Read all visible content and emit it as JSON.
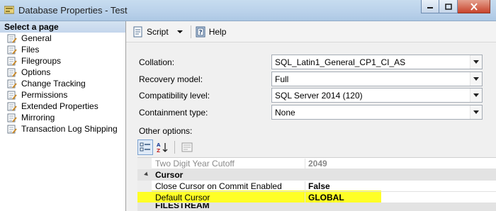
{
  "window": {
    "title": "Database Properties - Test"
  },
  "left_pane": {
    "header": "Select a page",
    "items": [
      {
        "label": "General"
      },
      {
        "label": "Files"
      },
      {
        "label": "Filegroups"
      },
      {
        "label": "Options"
      },
      {
        "label": "Change Tracking"
      },
      {
        "label": "Permissions"
      },
      {
        "label": "Extended Properties"
      },
      {
        "label": "Mirroring"
      },
      {
        "label": "Transaction Log Shipping"
      }
    ]
  },
  "toolbar": {
    "script_label": "Script",
    "help_label": "Help"
  },
  "options": {
    "collation": {
      "label": "Collation:",
      "value": "SQL_Latin1_General_CP1_CI_AS"
    },
    "recovery_model": {
      "label": "Recovery model:",
      "value": "Full"
    },
    "compatibility_level": {
      "label": "Compatibility level:",
      "value": "SQL Server 2014 (120)"
    },
    "containment_type": {
      "label": "Containment type:",
      "value": "None"
    },
    "other_options_label": "Other options:"
  },
  "property_grid": {
    "rows": [
      {
        "name": "Two Digit Year Cutoff",
        "value": "2049",
        "kind": "disabled"
      },
      {
        "name": "Cursor",
        "value": "",
        "kind": "category"
      },
      {
        "name": "Close Cursor on Commit Enabled",
        "value": "False",
        "kind": "property"
      },
      {
        "name": "Default Cursor",
        "value": "GLOBAL",
        "kind": "property",
        "highlighted": true
      },
      {
        "name": "FILESTREAM",
        "value": "",
        "kind": "category"
      }
    ]
  },
  "colors": {
    "highlight": "#ffff00",
    "titlebar": "#b9d1ea",
    "pane_background": "#f0f0f0"
  }
}
